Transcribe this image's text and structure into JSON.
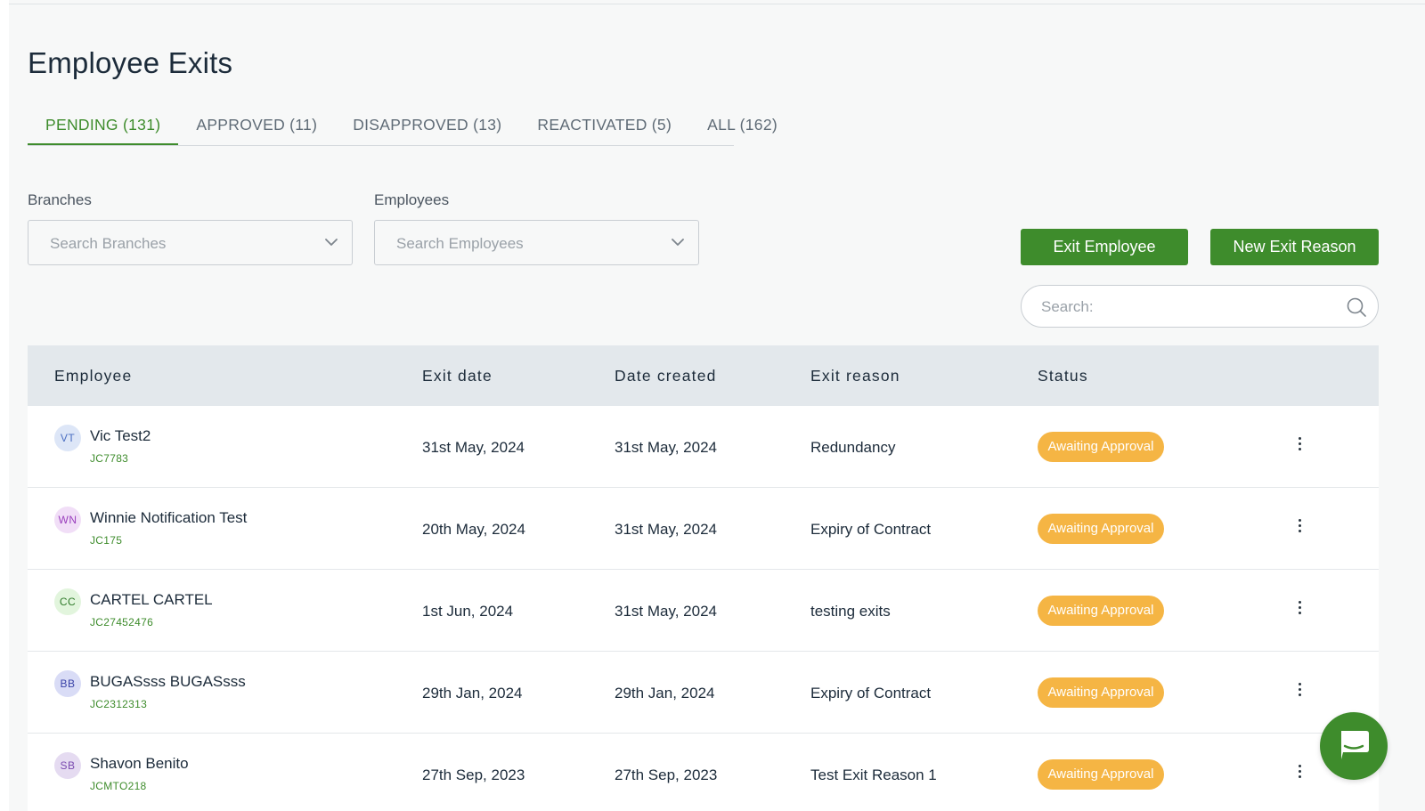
{
  "page": {
    "title": "Employee Exits"
  },
  "tabs": [
    {
      "label": "PENDING (131)",
      "active": true
    },
    {
      "label": "APPROVED (11)",
      "active": false
    },
    {
      "label": "DISAPPROVED (13)",
      "active": false
    },
    {
      "label": "REACTIVATED (5)",
      "active": false
    },
    {
      "label": "ALL (162)",
      "active": false
    }
  ],
  "filters": {
    "branches": {
      "label": "Branches",
      "placeholder": "Search Branches"
    },
    "employees": {
      "label": "Employees",
      "placeholder": "Search Employees"
    }
  },
  "actions": {
    "exit_employee": "Exit Employee",
    "new_exit_reason": "New Exit Reason"
  },
  "search": {
    "placeholder": "Search:"
  },
  "table": {
    "headers": {
      "employee": "Employee",
      "exit_date": "Exit date",
      "date_created": "Date created",
      "exit_reason": "Exit reason",
      "status": "Status"
    },
    "rows": [
      {
        "initials": "VT",
        "name": "Vic Test2",
        "code": "JC7783",
        "exit_date": "31st May, 2024",
        "date_created": "31st May, 2024",
        "exit_reason": "Redundancy",
        "status": "Awaiting Approval"
      },
      {
        "initials": "WN",
        "name": "Winnie Notification Test",
        "code": "JC175",
        "exit_date": "20th May, 2024",
        "date_created": "31st May, 2024",
        "exit_reason": "Expiry of Contract",
        "status": "Awaiting Approval"
      },
      {
        "initials": "CC",
        "name": "CARTEL CARTEL",
        "code": "JC27452476",
        "exit_date": "1st Jun, 2024",
        "date_created": "31st May, 2024",
        "exit_reason": "testing exits",
        "status": "Awaiting Approval"
      },
      {
        "initials": "BB",
        "name": "BUGASsss BUGASsss",
        "code": "JC2312313",
        "exit_date": "29th Jan, 2024",
        "date_created": "29th Jan, 2024",
        "exit_reason": "Expiry of Contract",
        "status": "Awaiting Approval"
      },
      {
        "initials": "SB",
        "name": "Shavon Benito",
        "code": "JCMTO218",
        "exit_date": "27th Sep, 2023",
        "date_created": "27th Sep, 2023",
        "exit_reason": "Test Exit Reason 1",
        "status": "Awaiting Approval"
      }
    ]
  },
  "colors": {
    "accent": "#3e8c2c",
    "status_pending": "#f5b544",
    "header_bg": "#e3e8ec",
    "avatars": [
      "#dde6f7",
      "#f1def7",
      "#e2f5dd",
      "#d9dcf6",
      "#e5dbf1"
    ],
    "avatar_text": [
      "#4b6fc2",
      "#9a3fbd",
      "#2f7a2a",
      "#3a43a8",
      "#7b4bb0"
    ]
  },
  "icons": {
    "chevron": "chevron-down-icon",
    "search": "search-icon",
    "more": "more-vertical-icon",
    "chat": "chat-bubble-icon"
  }
}
